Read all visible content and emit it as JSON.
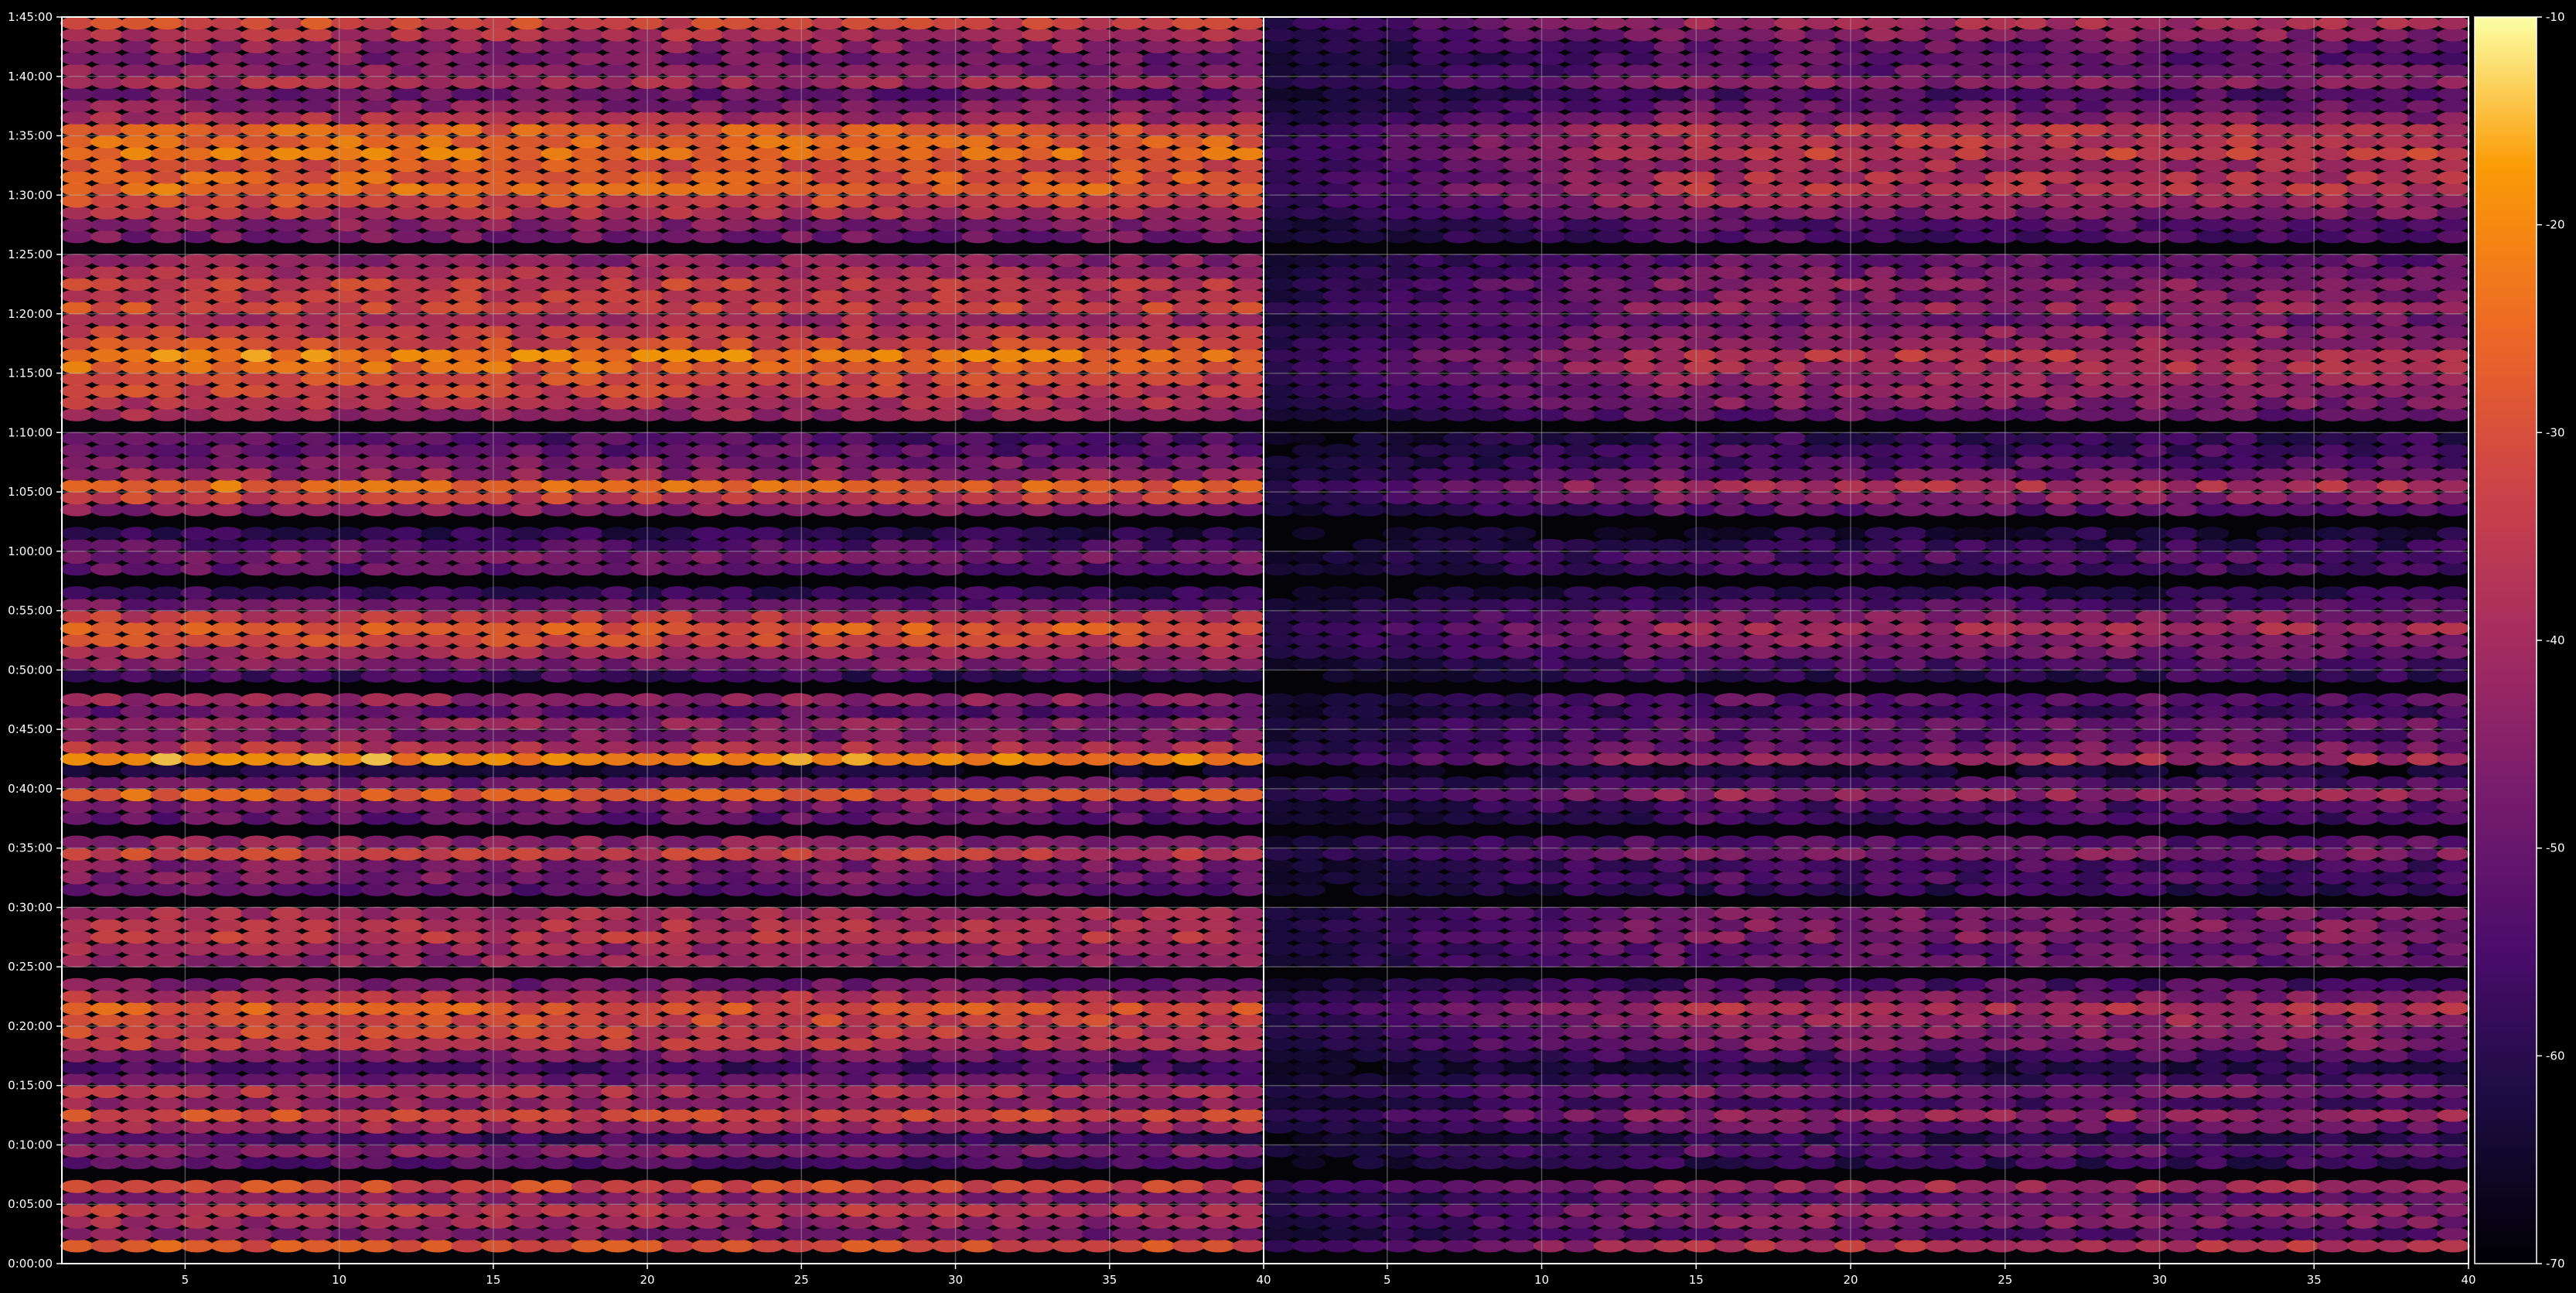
{
  "chart_data": {
    "type": "heatmap",
    "title": "",
    "xlabel": "",
    "ylabel": "",
    "panels": [
      {
        "name": "",
        "xlim": [
          1,
          40
        ],
        "xticks": [
          5,
          10,
          15,
          20,
          25,
          30,
          35,
          40
        ]
      },
      {
        "name": "",
        "xlim": [
          1,
          40
        ],
        "xticks": [
          5,
          10,
          15,
          20,
          25,
          30,
          35,
          40
        ]
      }
    ],
    "ylim": [
      0,
      105
    ],
    "y_units": "minutes",
    "yticks": [
      {
        "value": 0,
        "label": "0:00:00"
      },
      {
        "value": 5,
        "label": "0:05:00"
      },
      {
        "value": 10,
        "label": "0:10:00"
      },
      {
        "value": 15,
        "label": "0:15:00"
      },
      {
        "value": 20,
        "label": "0:20:00"
      },
      {
        "value": 25,
        "label": "0:25:00"
      },
      {
        "value": 30,
        "label": "0:30:00"
      },
      {
        "value": 35,
        "label": "0:35:00"
      },
      {
        "value": 40,
        "label": "0:40:00"
      },
      {
        "value": 45,
        "label": "0:45:00"
      },
      {
        "value": 50,
        "label": "0:50:00"
      },
      {
        "value": 55,
        "label": "0:55:00"
      },
      {
        "value": 60,
        "label": "1:00:00"
      },
      {
        "value": 65,
        "label": "1:05:00"
      },
      {
        "value": 70,
        "label": "1:10:00"
      },
      {
        "value": 75,
        "label": "1:15:00"
      },
      {
        "value": 80,
        "label": "1:20:00"
      },
      {
        "value": 85,
        "label": "1:25:00"
      },
      {
        "value": 90,
        "label": "1:30:00"
      },
      {
        "value": 95,
        "label": "1:35:00"
      },
      {
        "value": 100,
        "label": "1:40:00"
      },
      {
        "value": 105,
        "label": "1:45:00"
      }
    ],
    "grid": true,
    "colormap": "inferno",
    "colorbar": {
      "range": [
        -70,
        -10
      ],
      "ticks": [
        "-10",
        "-20",
        "-30",
        "-40",
        "-50",
        "-60",
        "-70"
      ],
      "placement": "right"
    },
    "row_profiles": [
      {
        "panel": 0,
        "bands": [
          [
            1,
            -28
          ],
          [
            2,
            -45
          ],
          [
            3,
            -40
          ],
          [
            4,
            -34
          ],
          [
            5,
            -44
          ],
          [
            6,
            -30
          ],
          [
            8,
            -52
          ],
          [
            9,
            -44
          ],
          [
            10,
            -55
          ],
          [
            11,
            -38
          ],
          [
            12,
            -30
          ],
          [
            13,
            -42
          ],
          [
            14,
            -36
          ],
          [
            15,
            -48
          ],
          [
            16,
            -54
          ],
          [
            17,
            -46
          ],
          [
            18,
            -34
          ],
          [
            19,
            -32
          ],
          [
            20,
            -30
          ],
          [
            21,
            -26
          ],
          [
            22,
            -36
          ],
          [
            23,
            -46
          ],
          [
            25,
            -42
          ],
          [
            26,
            -40
          ],
          [
            27,
            -34
          ],
          [
            28,
            -36
          ],
          [
            29,
            -38
          ],
          [
            31,
            -50
          ],
          [
            32,
            -46
          ],
          [
            33,
            -45
          ],
          [
            34,
            -32
          ],
          [
            35,
            -42
          ],
          [
            37,
            -50
          ],
          [
            38,
            -46
          ],
          [
            39,
            -26
          ],
          [
            40,
            -48
          ],
          [
            41,
            -62
          ],
          [
            42,
            -18
          ],
          [
            43,
            -36
          ],
          [
            44,
            -45
          ],
          [
            45,
            -42
          ],
          [
            46,
            -50
          ],
          [
            47,
            -42
          ],
          [
            49,
            -55
          ],
          [
            50,
            -44
          ],
          [
            51,
            -38
          ],
          [
            52,
            -30
          ],
          [
            53,
            -26
          ],
          [
            54,
            -34
          ],
          [
            55,
            -48
          ],
          [
            56,
            -56
          ],
          [
            58,
            -50
          ],
          [
            59,
            -46
          ],
          [
            60,
            -52
          ],
          [
            61,
            -58
          ],
          [
            63,
            -44
          ],
          [
            64,
            -32
          ],
          [
            65,
            -24
          ],
          [
            66,
            -42
          ],
          [
            67,
            -46
          ],
          [
            68,
            -50
          ],
          [
            69,
            -52
          ],
          [
            71,
            -40
          ],
          [
            72,
            -36
          ],
          [
            73,
            -32
          ],
          [
            74,
            -30
          ],
          [
            75,
            -24
          ],
          [
            76,
            -20
          ],
          [
            77,
            -30
          ],
          [
            78,
            -34
          ],
          [
            79,
            -38
          ],
          [
            80,
            -30
          ],
          [
            81,
            -34
          ],
          [
            82,
            -32
          ],
          [
            83,
            -38
          ],
          [
            84,
            -42
          ],
          [
            86,
            -46
          ],
          [
            87,
            -44
          ],
          [
            88,
            -36
          ],
          [
            89,
            -30
          ],
          [
            90,
            -24
          ],
          [
            91,
            -26
          ],
          [
            92,
            -28
          ],
          [
            93,
            -22
          ],
          [
            94,
            -24
          ],
          [
            95,
            -26
          ],
          [
            96,
            -38
          ],
          [
            97,
            -44
          ],
          [
            98,
            -48
          ],
          [
            99,
            -38
          ],
          [
            100,
            -44
          ],
          [
            101,
            -46
          ],
          [
            102,
            -42
          ],
          [
            103,
            -36
          ],
          [
            104,
            -30
          ]
        ]
      },
      {
        "panel": 1,
        "bands": [
          [
            1,
            -36
          ],
          [
            2,
            -52
          ],
          [
            3,
            -46
          ],
          [
            4,
            -44
          ],
          [
            5,
            -52
          ],
          [
            6,
            -40
          ],
          [
            8,
            -58
          ],
          [
            9,
            -52
          ],
          [
            10,
            -60
          ],
          [
            11,
            -50
          ],
          [
            12,
            -42
          ],
          [
            13,
            -54
          ],
          [
            14,
            -46
          ],
          [
            15,
            -56
          ],
          [
            16,
            -60
          ],
          [
            17,
            -54
          ],
          [
            18,
            -46
          ],
          [
            19,
            -46
          ],
          [
            20,
            -42
          ],
          [
            21,
            -38
          ],
          [
            22,
            -46
          ],
          [
            23,
            -54
          ],
          [
            25,
            -50
          ],
          [
            26,
            -50
          ],
          [
            27,
            -46
          ],
          [
            28,
            -46
          ],
          [
            29,
            -48
          ],
          [
            31,
            -58
          ],
          [
            32,
            -54
          ],
          [
            33,
            -55
          ],
          [
            34,
            -46
          ],
          [
            35,
            -52
          ],
          [
            37,
            -56
          ],
          [
            38,
            -54
          ],
          [
            39,
            -42
          ],
          [
            40,
            -54
          ],
          [
            41,
            -64
          ],
          [
            42,
            -40
          ],
          [
            43,
            -48
          ],
          [
            44,
            -52
          ],
          [
            45,
            -50
          ],
          [
            46,
            -56
          ],
          [
            47,
            -52
          ],
          [
            49,
            -58
          ],
          [
            50,
            -54
          ],
          [
            51,
            -48
          ],
          [
            52,
            -44
          ],
          [
            53,
            -40
          ],
          [
            54,
            -46
          ],
          [
            55,
            -54
          ],
          [
            56,
            -60
          ],
          [
            58,
            -56
          ],
          [
            59,
            -54
          ],
          [
            60,
            -58
          ],
          [
            61,
            -62
          ],
          [
            63,
            -52
          ],
          [
            64,
            -44
          ],
          [
            65,
            -38
          ],
          [
            66,
            -50
          ],
          [
            67,
            -54
          ],
          [
            68,
            -56
          ],
          [
            69,
            -58
          ],
          [
            71,
            -50
          ],
          [
            72,
            -46
          ],
          [
            73,
            -44
          ],
          [
            74,
            -42
          ],
          [
            75,
            -38
          ],
          [
            76,
            -36
          ],
          [
            77,
            -42
          ],
          [
            78,
            -44
          ],
          [
            79,
            -48
          ],
          [
            80,
            -42
          ],
          [
            81,
            -46
          ],
          [
            82,
            -44
          ],
          [
            83,
            -48
          ],
          [
            84,
            -50
          ],
          [
            86,
            -54
          ],
          [
            87,
            -52
          ],
          [
            88,
            -46
          ],
          [
            89,
            -40
          ],
          [
            90,
            -36
          ],
          [
            91,
            -38
          ],
          [
            92,
            -40
          ],
          [
            93,
            -34
          ],
          [
            94,
            -36
          ],
          [
            95,
            -36
          ],
          [
            96,
            -46
          ],
          [
            97,
            -50
          ],
          [
            98,
            -54
          ],
          [
            99,
            -44
          ],
          [
            100,
            -50
          ],
          [
            101,
            -52
          ],
          [
            102,
            -50
          ],
          [
            103,
            -44
          ],
          [
            104,
            -40
          ]
        ]
      }
    ]
  }
}
